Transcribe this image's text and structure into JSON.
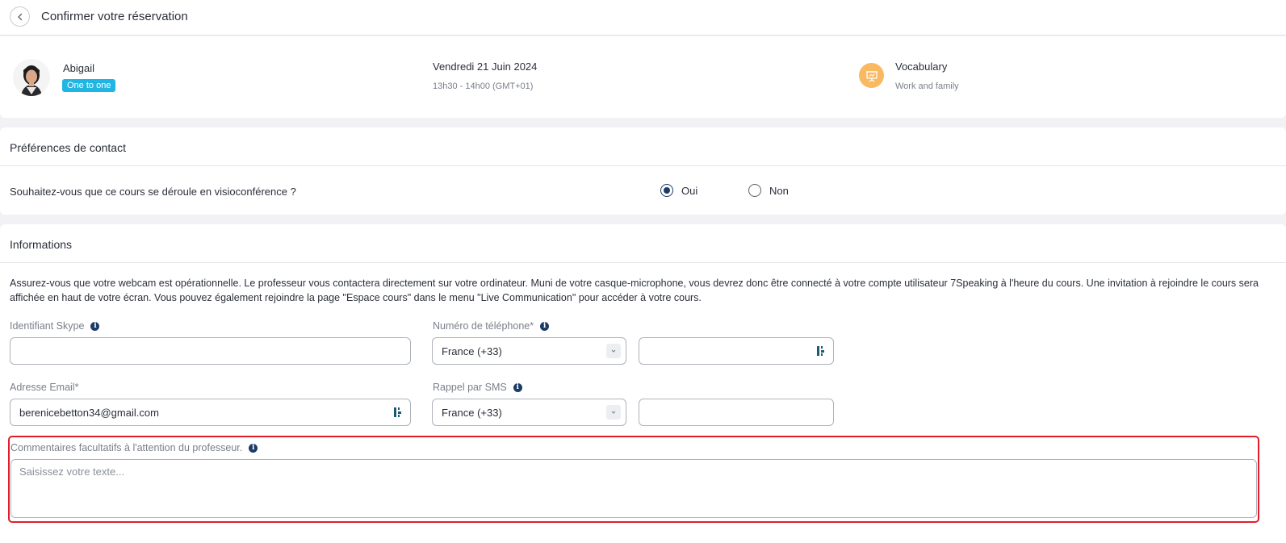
{
  "header": {
    "title": "Confirmer votre réservation"
  },
  "booking": {
    "teacher_name": "Abigail",
    "badge": "One to one",
    "date": "Vendredi 21 Juin 2024",
    "time": "13h30 - 14h00 (GMT+01)",
    "topic_title": "Vocabulary",
    "topic_sub": "Work and family",
    "topic_color": "#f9b963",
    "badge_color": "#1fb6e4"
  },
  "contact": {
    "title": "Préférences de contact",
    "question": "Souhaitez-vous que ce cours se déroule en visioconférence ?",
    "options": [
      {
        "label": "Oui",
        "checked": true
      },
      {
        "label": "Non",
        "checked": false
      }
    ]
  },
  "info": {
    "title": "Informations",
    "paragraph": "Assurez-vous que votre webcam est opérationnelle. Le professeur vous contactera directement sur votre ordinateur. Muni de votre casque-microphone, vous devrez donc être connecté à votre compte utilisateur 7Speaking à l'heure du cours. Une invitation à rejoindre le cours sera affichée en haut de votre écran. Vous pouvez également rejoindre la page \"Espace cours\" dans le menu \"Live Communication\" pour accéder à votre cours.",
    "skype_label": "Identifiant Skype",
    "skype_value": "",
    "phone_label": "Numéro de téléphone*",
    "phone_country": "France (+33)",
    "phone_value": "",
    "email_label": "Adresse Email*",
    "email_value": "berenicebetton34@gmail.com",
    "sms_label": "Rappel par SMS",
    "sms_country": "France (+33)",
    "sms_value": "",
    "comment_label": "Commentaires facultatifs à l'attention du professeur.",
    "comment_placeholder": "Saisissez votre texte..."
  }
}
